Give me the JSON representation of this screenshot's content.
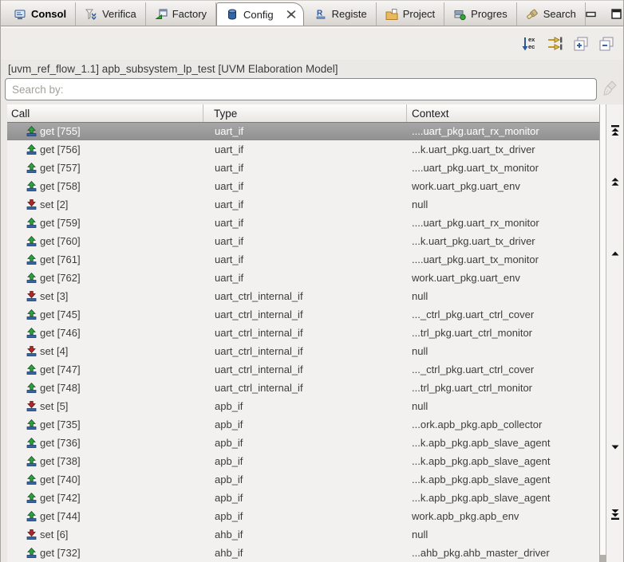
{
  "window": {
    "tabs": [
      {
        "label": "Consol",
        "icon": "console-icon",
        "active": false,
        "bold": true
      },
      {
        "label": "Verifica",
        "icon": "verification-icon",
        "active": false
      },
      {
        "label": "Factory",
        "icon": "factory-icon",
        "active": false
      },
      {
        "label": "Config",
        "icon": "config-icon",
        "active": true,
        "close_icon": "close-icon"
      },
      {
        "label": "Registe",
        "icon": "register-icon",
        "active": false
      },
      {
        "label": "Project",
        "icon": "project-icon",
        "active": false
      },
      {
        "label": "Progres",
        "icon": "progress-icon",
        "active": false
      },
      {
        "label": "Search",
        "icon": "search-icon",
        "active": false
      }
    ],
    "controls": [
      "minimize-icon",
      "maximize-icon"
    ]
  },
  "toolbar": {
    "buttons": [
      {
        "icon": "sort-exec-order-icon",
        "text": "ex ec"
      },
      {
        "icon": "follow-pointer-icon"
      },
      {
        "icon": "expand-all-icon"
      },
      {
        "icon": "collapse-all-icon"
      }
    ]
  },
  "header": {
    "title": "[uvm_ref_flow_1.1] apb_subsystem_lp_test [UVM Elaboration Model]"
  },
  "search": {
    "placeholder": "Search by:",
    "value": "",
    "clear_icon": "broom-icon"
  },
  "table": {
    "columns": [
      "Call",
      "Type",
      "Context"
    ],
    "rows": [
      {
        "op": "get",
        "call": "get [755]",
        "type": "uart_if",
        "context": "....uart_pkg.uart_rx_monitor",
        "selected": true
      },
      {
        "op": "get",
        "call": "get [756]",
        "type": "uart_if",
        "context": "...k.uart_pkg.uart_tx_driver"
      },
      {
        "op": "get",
        "call": "get [757]",
        "type": "uart_if",
        "context": "....uart_pkg.uart_tx_monitor"
      },
      {
        "op": "get",
        "call": "get [758]",
        "type": "uart_if",
        "context": "work.uart_pkg.uart_env"
      },
      {
        "op": "set",
        "call": "set [2]",
        "type": "uart_if",
        "context": "null"
      },
      {
        "op": "get",
        "call": "get [759]",
        "type": "uart_if",
        "context": "....uart_pkg.uart_rx_monitor"
      },
      {
        "op": "get",
        "call": "get [760]",
        "type": "uart_if",
        "context": "...k.uart_pkg.uart_tx_driver"
      },
      {
        "op": "get",
        "call": "get [761]",
        "type": "uart_if",
        "context": "....uart_pkg.uart_tx_monitor"
      },
      {
        "op": "get",
        "call": "get [762]",
        "type": "uart_if",
        "context": "work.uart_pkg.uart_env"
      },
      {
        "op": "set",
        "call": "set [3]",
        "type": "uart_ctrl_internal_if",
        "context": "null"
      },
      {
        "op": "get",
        "call": "get [745]",
        "type": "uart_ctrl_internal_if",
        "context": "..._ctrl_pkg.uart_ctrl_cover"
      },
      {
        "op": "get",
        "call": "get [746]",
        "type": "uart_ctrl_internal_if",
        "context": "...trl_pkg.uart_ctrl_monitor"
      },
      {
        "op": "set",
        "call": "set [4]",
        "type": "uart_ctrl_internal_if",
        "context": "null"
      },
      {
        "op": "get",
        "call": "get [747]",
        "type": "uart_ctrl_internal_if",
        "context": "..._ctrl_pkg.uart_ctrl_cover"
      },
      {
        "op": "get",
        "call": "get [748]",
        "type": "uart_ctrl_internal_if",
        "context": "...trl_pkg.uart_ctrl_monitor"
      },
      {
        "op": "set",
        "call": "set [5]",
        "type": "apb_if",
        "context": "null"
      },
      {
        "op": "get",
        "call": "get [735]",
        "type": "apb_if",
        "context": "...ork.apb_pkg.apb_collector"
      },
      {
        "op": "get",
        "call": "get [736]",
        "type": "apb_if",
        "context": "...k.apb_pkg.apb_slave_agent"
      },
      {
        "op": "get",
        "call": "get [738]",
        "type": "apb_if",
        "context": "...k.apb_pkg.apb_slave_agent"
      },
      {
        "op": "get",
        "call": "get [740]",
        "type": "apb_if",
        "context": "...k.apb_pkg.apb_slave_agent"
      },
      {
        "op": "get",
        "call": "get [742]",
        "type": "apb_if",
        "context": "...k.apb_pkg.apb_slave_agent"
      },
      {
        "op": "get",
        "call": "get [744]",
        "type": "apb_if",
        "context": "work.apb_pkg.apb_env"
      },
      {
        "op": "set",
        "call": "set [6]",
        "type": "ahb_if",
        "context": "null"
      },
      {
        "op": "get",
        "call": "get [732]",
        "type": "ahb_if",
        "context": "...ahb_pkg.ahb_master_driver"
      }
    ]
  },
  "scroll_nav": {
    "icons": [
      "scroll-to-top-icon",
      "page-up-icon",
      "up-icon",
      "down-icon",
      "scroll-to-bottom-icon"
    ]
  },
  "colors": {
    "selection_bg": "#9a9a9a",
    "selection_text": "#ffffff",
    "get_arrow": "#2e9e40",
    "set_arrow": "#b02828",
    "icon_base_bar": "#3465a4",
    "tab_active_bg": "#ffffff",
    "accent_gold": "#c9971c"
  }
}
